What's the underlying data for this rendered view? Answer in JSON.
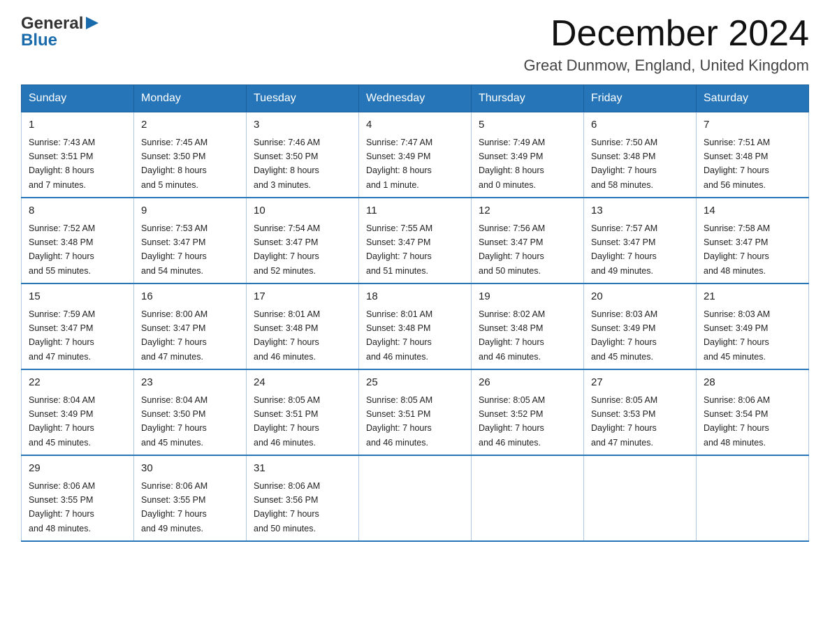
{
  "logo": {
    "general": "General",
    "arrow": "▶",
    "blue": "Blue"
  },
  "title": "December 2024",
  "location": "Great Dunmow, England, United Kingdom",
  "days_of_week": [
    "Sunday",
    "Monday",
    "Tuesday",
    "Wednesday",
    "Thursday",
    "Friday",
    "Saturday"
  ],
  "weeks": [
    [
      {
        "day": "1",
        "sunrise": "7:43 AM",
        "sunset": "3:51 PM",
        "daylight": "8 hours and 7 minutes."
      },
      {
        "day": "2",
        "sunrise": "7:45 AM",
        "sunset": "3:50 PM",
        "daylight": "8 hours and 5 minutes."
      },
      {
        "day": "3",
        "sunrise": "7:46 AM",
        "sunset": "3:50 PM",
        "daylight": "8 hours and 3 minutes."
      },
      {
        "day": "4",
        "sunrise": "7:47 AM",
        "sunset": "3:49 PM",
        "daylight": "8 hours and 1 minute."
      },
      {
        "day": "5",
        "sunrise": "7:49 AM",
        "sunset": "3:49 PM",
        "daylight": "8 hours and 0 minutes."
      },
      {
        "day": "6",
        "sunrise": "7:50 AM",
        "sunset": "3:48 PM",
        "daylight": "7 hours and 58 minutes."
      },
      {
        "day": "7",
        "sunrise": "7:51 AM",
        "sunset": "3:48 PM",
        "daylight": "7 hours and 56 minutes."
      }
    ],
    [
      {
        "day": "8",
        "sunrise": "7:52 AM",
        "sunset": "3:48 PM",
        "daylight": "7 hours and 55 minutes."
      },
      {
        "day": "9",
        "sunrise": "7:53 AM",
        "sunset": "3:47 PM",
        "daylight": "7 hours and 54 minutes."
      },
      {
        "day": "10",
        "sunrise": "7:54 AM",
        "sunset": "3:47 PM",
        "daylight": "7 hours and 52 minutes."
      },
      {
        "day": "11",
        "sunrise": "7:55 AM",
        "sunset": "3:47 PM",
        "daylight": "7 hours and 51 minutes."
      },
      {
        "day": "12",
        "sunrise": "7:56 AM",
        "sunset": "3:47 PM",
        "daylight": "7 hours and 50 minutes."
      },
      {
        "day": "13",
        "sunrise": "7:57 AM",
        "sunset": "3:47 PM",
        "daylight": "7 hours and 49 minutes."
      },
      {
        "day": "14",
        "sunrise": "7:58 AM",
        "sunset": "3:47 PM",
        "daylight": "7 hours and 48 minutes."
      }
    ],
    [
      {
        "day": "15",
        "sunrise": "7:59 AM",
        "sunset": "3:47 PM",
        "daylight": "7 hours and 47 minutes."
      },
      {
        "day": "16",
        "sunrise": "8:00 AM",
        "sunset": "3:47 PM",
        "daylight": "7 hours and 47 minutes."
      },
      {
        "day": "17",
        "sunrise": "8:01 AM",
        "sunset": "3:48 PM",
        "daylight": "7 hours and 46 minutes."
      },
      {
        "day": "18",
        "sunrise": "8:01 AM",
        "sunset": "3:48 PM",
        "daylight": "7 hours and 46 minutes."
      },
      {
        "day": "19",
        "sunrise": "8:02 AM",
        "sunset": "3:48 PM",
        "daylight": "7 hours and 46 minutes."
      },
      {
        "day": "20",
        "sunrise": "8:03 AM",
        "sunset": "3:49 PM",
        "daylight": "7 hours and 45 minutes."
      },
      {
        "day": "21",
        "sunrise": "8:03 AM",
        "sunset": "3:49 PM",
        "daylight": "7 hours and 45 minutes."
      }
    ],
    [
      {
        "day": "22",
        "sunrise": "8:04 AM",
        "sunset": "3:49 PM",
        "daylight": "7 hours and 45 minutes."
      },
      {
        "day": "23",
        "sunrise": "8:04 AM",
        "sunset": "3:50 PM",
        "daylight": "7 hours and 45 minutes."
      },
      {
        "day": "24",
        "sunrise": "8:05 AM",
        "sunset": "3:51 PM",
        "daylight": "7 hours and 46 minutes."
      },
      {
        "day": "25",
        "sunrise": "8:05 AM",
        "sunset": "3:51 PM",
        "daylight": "7 hours and 46 minutes."
      },
      {
        "day": "26",
        "sunrise": "8:05 AM",
        "sunset": "3:52 PM",
        "daylight": "7 hours and 46 minutes."
      },
      {
        "day": "27",
        "sunrise": "8:05 AM",
        "sunset": "3:53 PM",
        "daylight": "7 hours and 47 minutes."
      },
      {
        "day": "28",
        "sunrise": "8:06 AM",
        "sunset": "3:54 PM",
        "daylight": "7 hours and 48 minutes."
      }
    ],
    [
      {
        "day": "29",
        "sunrise": "8:06 AM",
        "sunset": "3:55 PM",
        "daylight": "7 hours and 48 minutes."
      },
      {
        "day": "30",
        "sunrise": "8:06 AM",
        "sunset": "3:55 PM",
        "daylight": "7 hours and 49 minutes."
      },
      {
        "day": "31",
        "sunrise": "8:06 AM",
        "sunset": "3:56 PM",
        "daylight": "7 hours and 50 minutes."
      },
      null,
      null,
      null,
      null
    ]
  ],
  "labels": {
    "sunrise": "Sunrise:",
    "sunset": "Sunset:",
    "daylight": "Daylight:"
  }
}
